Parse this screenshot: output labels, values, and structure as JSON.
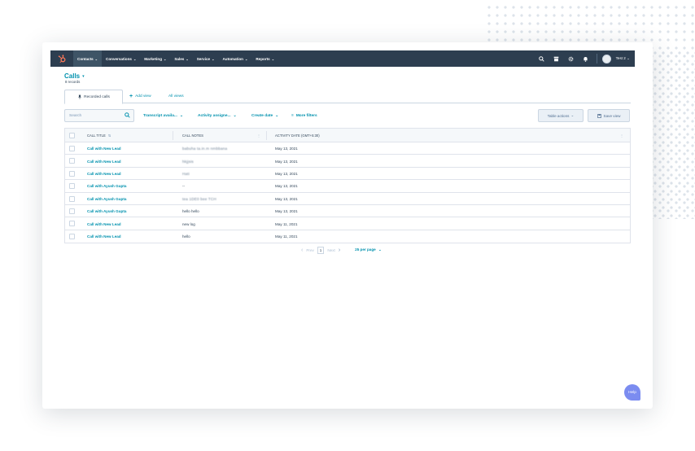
{
  "nav": {
    "items": [
      {
        "label": "Contacts",
        "active": true
      },
      {
        "label": "Conversations",
        "active": false
      },
      {
        "label": "Marketing",
        "active": false
      },
      {
        "label": "Sales",
        "active": false
      },
      {
        "label": "Service",
        "active": false
      },
      {
        "label": "Automation",
        "active": false
      },
      {
        "label": "Reports",
        "active": false
      }
    ],
    "caret": "⌄",
    "icons": [
      "search-icon",
      "marketplace-icon",
      "settings-icon",
      "notifications-icon"
    ],
    "account_label": "Test 2 ⌄"
  },
  "page": {
    "title": "Calls",
    "title_caret": "▾",
    "record_count": "8 records"
  },
  "tabs": {
    "active_label": "Recorded calls",
    "add_view": "Add view",
    "all_views": "All views"
  },
  "filters": {
    "search_placeholder": "Search",
    "transcript": "Transcript availa...",
    "activity_assignee": "Activity assigne...",
    "create_date": "Create date",
    "more_filters": "More filters",
    "table_actions": "Table actions",
    "save_view": "Save view"
  },
  "table": {
    "headers": {
      "call_title": "CALL TITLE",
      "call_notes": "CALL NOTES",
      "activity_date": "ACTIVITY DATE (GMT+5:30)"
    },
    "rows": [
      {
        "title": "Call with New Lead",
        "notes": "babuha ta.in.m nmbbana",
        "blurred": true,
        "date": "May 13, 2021"
      },
      {
        "title": "Call with New Lead",
        "notes": "hkjjsis",
        "blurred": true,
        "date": "May 13, 2021"
      },
      {
        "title": "Call with New Lead",
        "notes": "Hati",
        "blurred": true,
        "date": "May 13, 2021"
      },
      {
        "title": "Call with Ayush Gupta",
        "notes": "--",
        "blurred": false,
        "date": "May 13, 2021"
      },
      {
        "title": "Call with Ayush Gupta",
        "notes": "tea 1DE0 bee TCH",
        "blurred": true,
        "date": "May 13, 2021"
      },
      {
        "title": "Call with Ayush Gupta",
        "notes": "hello hello",
        "blurred": false,
        "date": "May 13, 2021"
      },
      {
        "title": "Call with New Lead",
        "notes": "new log",
        "blurred": false,
        "date": "May 11, 2021"
      },
      {
        "title": "Call with New Lead",
        "notes": "hello",
        "blurred": false,
        "date": "May 11, 2021"
      }
    ]
  },
  "pagination": {
    "prev": "Prev",
    "page": "1",
    "next": "Next",
    "per_page": "25 per page"
  },
  "help_label": "Help",
  "colors": {
    "topbar": "#2d3e50",
    "link": "#0091ae",
    "text": "#33475b",
    "help": "#7b8cf0"
  }
}
